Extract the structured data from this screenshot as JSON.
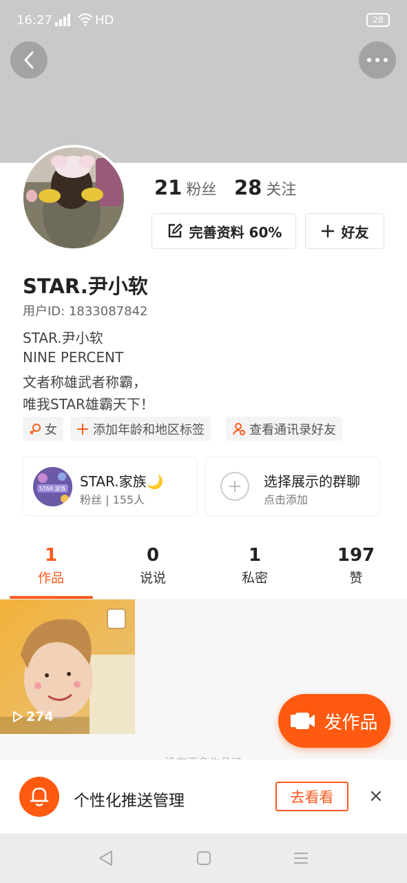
{
  "status_bar": {
    "time": "16:27",
    "network": "4G",
    "hd": "HD",
    "battery": "28"
  },
  "header": {
    "back_icon": "back-arrow-icon",
    "more_icon": "more-dots-icon"
  },
  "profile": {
    "followers_count": "21",
    "followers_label": "粉丝",
    "following_count": "28",
    "following_label": "关注",
    "complete_profile_label": "完善资料 60%",
    "add_friend_label": "好友",
    "username": "STAR.尹小软",
    "user_id": "用户ID: 1833087842",
    "bio": [
      "STAR.尹小软",
      "NINE PERCENT",
      "文者称雄武者称霸，",
      "唯我STAR雄霸天下！"
    ]
  },
  "tags": [
    {
      "icon": "female-icon",
      "label": "女"
    },
    {
      "icon": "plus-icon",
      "label": "添加年龄和地区标签"
    },
    {
      "icon": "contacts-icon",
      "label": "查看通讯录好友"
    }
  ],
  "groups": {
    "family": {
      "title": "STAR.家族🌙",
      "subtitle": "粉丝 | 155人",
      "avatar_text": "STAR.家族"
    },
    "group_chat": {
      "title": "选择展示的群聊",
      "subtitle": "点击添加"
    }
  },
  "tabs": [
    {
      "count": "1",
      "label": "作品",
      "active": true
    },
    {
      "count": "0",
      "label": "说说",
      "active": false
    },
    {
      "count": "1",
      "label": "私密",
      "active": false
    },
    {
      "count": "197",
      "label": "赞",
      "active": false
    }
  ],
  "works": [
    {
      "play_count": "274"
    }
  ],
  "publish_button": {
    "label": "发作品"
  },
  "more_hint": "没有更多作品了",
  "push_banner": {
    "text": "个性化推送管理",
    "button": "去看看",
    "close": "×"
  },
  "colors": {
    "accent": "#ff5a1c",
    "cover": "#c9c9c9"
  }
}
